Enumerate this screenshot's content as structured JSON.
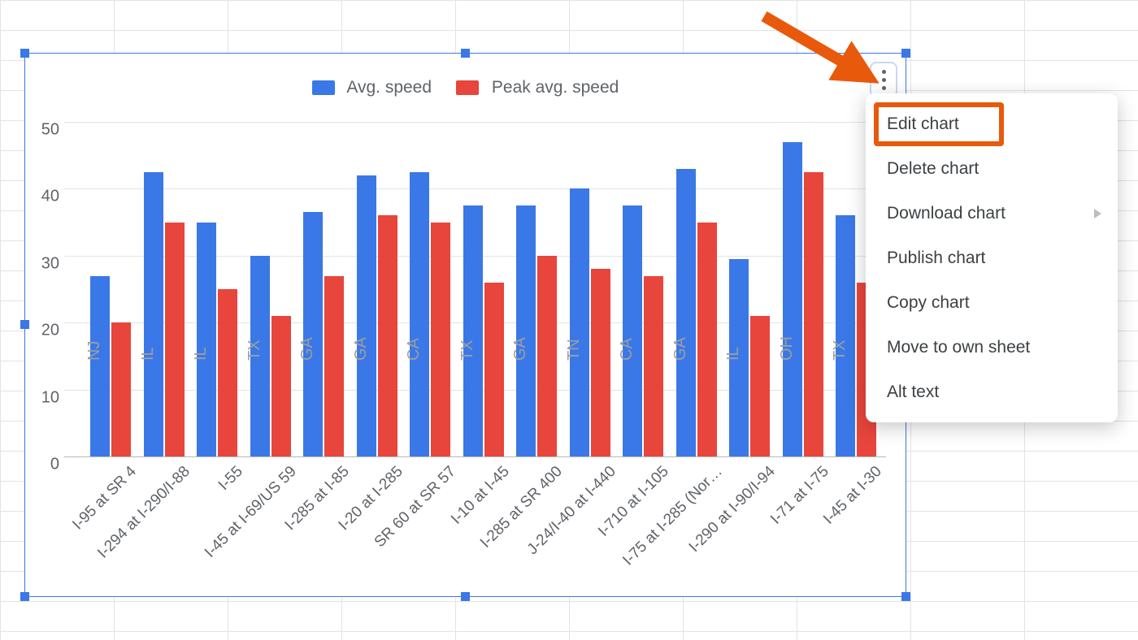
{
  "chart_data": {
    "type": "bar",
    "categories": [
      "I-95 at SR 4",
      "I-294 at I-290/I-88",
      "I-55",
      "I-45 at I-69/US 59",
      "I-285 at I-85",
      "I-20 at I-285",
      "SR 60 at SR 57",
      "I-10 at I-45",
      "I-285 at SR 400",
      "J-24/I-40 at I-440",
      "I-710 at I-105",
      "I-75 at I-285 (Nor…",
      "I-290 at I-90/I-94",
      "I-71 at I-75",
      "I-45 at I-30"
    ],
    "state_labels": [
      "NJ",
      "IL",
      "IL",
      "TX",
      "GA",
      "GA",
      "CA",
      "TX",
      "GA",
      "TN",
      "CA",
      "GA",
      "IL",
      "OH",
      "TX"
    ],
    "series": [
      {
        "name": "Avg. speed",
        "color": "#3b78e7",
        "values": [
          27,
          42.5,
          35,
          30,
          36.5,
          42,
          42.5,
          37.5,
          37.5,
          40,
          37.5,
          43,
          29.5,
          47,
          36
        ]
      },
      {
        "name": "Peak avg. speed",
        "color": "#e8453c",
        "values": [
          20,
          35,
          25,
          21,
          27,
          36,
          35,
          26,
          30,
          28,
          27,
          35,
          21,
          42.5,
          26
        ]
      }
    ],
    "ylim": [
      0,
      50
    ],
    "yticks": [
      0,
      10,
      20,
      30,
      40,
      50
    ],
    "xlabel": "",
    "ylabel": ""
  },
  "context_menu": {
    "items": [
      {
        "label": "Edit chart",
        "submenu": false
      },
      {
        "label": "Delete chart",
        "submenu": false
      },
      {
        "label": "Download chart",
        "submenu": true
      },
      {
        "label": "Publish chart",
        "submenu": false
      },
      {
        "label": "Copy chart",
        "submenu": false
      },
      {
        "label": "Move to own sheet",
        "submenu": false
      },
      {
        "label": "Alt text",
        "submenu": false
      }
    ]
  }
}
